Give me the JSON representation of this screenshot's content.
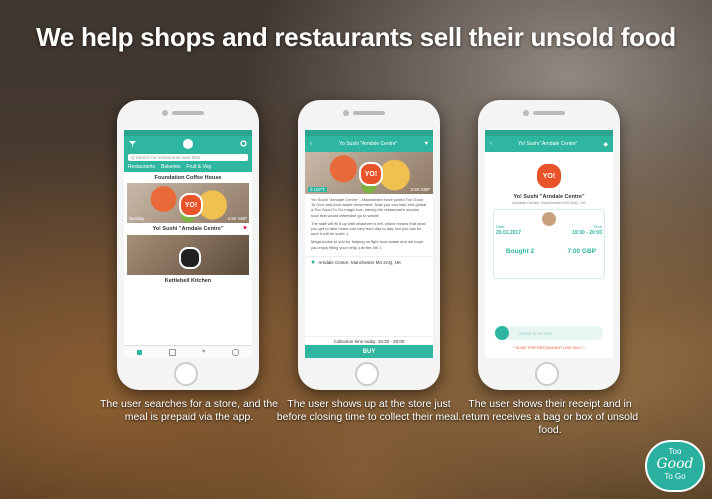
{
  "headline": "We help shops and restaurants sell their unsold food",
  "colors": {
    "accent": "#2fb6a0",
    "yo_red": "#e8532a"
  },
  "phone1": {
    "search_placeholder": "Q  Search for restaurants near 0km",
    "tabs": [
      "Restaurants",
      "Bakeries",
      "Fruit & Veg"
    ],
    "listings": [
      {
        "name": "Foundation Coffee House",
        "left": "",
        "right": ""
      },
      {
        "name": "Yo! Sushi \"Arndale Centre\"",
        "left": "Sunday",
        "right": "4.50 GBP"
      },
      {
        "name": "Kettlebell Kitchen",
        "left": "",
        "right": ""
      }
    ],
    "nav_icons": [
      "home-icon",
      "list-icon",
      "heart-icon",
      "profile-icon"
    ]
  },
  "phone2": {
    "title": "Yo Sushi \"Arndale Centre\"",
    "price_left": "0 LEFT",
    "price_right": "3.50 GBP",
    "paragraph1": "Yo! Sushi \"Arndale Centre\" - Manchester have joined Too Good To Go's anti-food waste movement. Now you can help end global a Too Good To Go magic box, saving the restaurant's surplus food that would otherwise go to waste!",
    "paragraph2": "The staff will fill it up with whatever is left, which means that what you get to take home can vary from day to day, but you can be sure it will be sushi :)",
    "paragraph3": "Mega kudos to you for helping us fight food waste and we hope you enjoy filling your belly, just the 4th 1",
    "address": "Arndale Centre, Manchester M4 3AQ, UK",
    "collection": "Collection time today: 19:30 - 20:00",
    "buy_label": "BUY"
  },
  "phone3": {
    "title": "Yo! Sushi \"Arndale Centre\"",
    "store": "Yo! Sushi \"Arndale Centre\"",
    "address": "Arndale Centre, Manchester M4 3AQ, UK",
    "date_label": "Date",
    "date": "20.01.2017",
    "time_label": "Time",
    "time": "19:30 - 20:00",
    "bought_label": "Bought 2",
    "total": "7.00 GBP",
    "slider_text": "Swipe to receive",
    "footer_note": "* SLIDE FOR RESTAURANT USE ONLY *"
  },
  "captions": [
    "The user searches for a store, and the meal is prepaid via the app.",
    "The user shows up at the store just before closing time to collect their meal.",
    "The user shows their receipt and in return receives a bag or box of unsold food."
  ],
  "badge": {
    "top": "Too",
    "middle": "Good",
    "bottom": "To Go"
  }
}
